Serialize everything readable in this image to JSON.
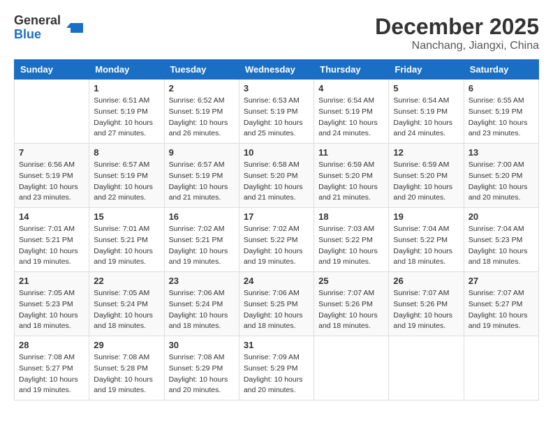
{
  "logo": {
    "general": "General",
    "blue": "Blue"
  },
  "title": "December 2025",
  "location": "Nanchang, Jiangxi, China",
  "headers": [
    "Sunday",
    "Monday",
    "Tuesday",
    "Wednesday",
    "Thursday",
    "Friday",
    "Saturday"
  ],
  "weeks": [
    [
      {
        "day": "",
        "sunrise": "",
        "sunset": "",
        "daylight": ""
      },
      {
        "day": "1",
        "sunrise": "Sunrise: 6:51 AM",
        "sunset": "Sunset: 5:19 PM",
        "daylight": "Daylight: 10 hours and 27 minutes."
      },
      {
        "day": "2",
        "sunrise": "Sunrise: 6:52 AM",
        "sunset": "Sunset: 5:19 PM",
        "daylight": "Daylight: 10 hours and 26 minutes."
      },
      {
        "day": "3",
        "sunrise": "Sunrise: 6:53 AM",
        "sunset": "Sunset: 5:19 PM",
        "daylight": "Daylight: 10 hours and 25 minutes."
      },
      {
        "day": "4",
        "sunrise": "Sunrise: 6:54 AM",
        "sunset": "Sunset: 5:19 PM",
        "daylight": "Daylight: 10 hours and 24 minutes."
      },
      {
        "day": "5",
        "sunrise": "Sunrise: 6:54 AM",
        "sunset": "Sunset: 5:19 PM",
        "daylight": "Daylight: 10 hours and 24 minutes."
      },
      {
        "day": "6",
        "sunrise": "Sunrise: 6:55 AM",
        "sunset": "Sunset: 5:19 PM",
        "daylight": "Daylight: 10 hours and 23 minutes."
      }
    ],
    [
      {
        "day": "7",
        "sunrise": "Sunrise: 6:56 AM",
        "sunset": "Sunset: 5:19 PM",
        "daylight": "Daylight: 10 hours and 23 minutes."
      },
      {
        "day": "8",
        "sunrise": "Sunrise: 6:57 AM",
        "sunset": "Sunset: 5:19 PM",
        "daylight": "Daylight: 10 hours and 22 minutes."
      },
      {
        "day": "9",
        "sunrise": "Sunrise: 6:57 AM",
        "sunset": "Sunset: 5:19 PM",
        "daylight": "Daylight: 10 hours and 21 minutes."
      },
      {
        "day": "10",
        "sunrise": "Sunrise: 6:58 AM",
        "sunset": "Sunset: 5:20 PM",
        "daylight": "Daylight: 10 hours and 21 minutes."
      },
      {
        "day": "11",
        "sunrise": "Sunrise: 6:59 AM",
        "sunset": "Sunset: 5:20 PM",
        "daylight": "Daylight: 10 hours and 21 minutes."
      },
      {
        "day": "12",
        "sunrise": "Sunrise: 6:59 AM",
        "sunset": "Sunset: 5:20 PM",
        "daylight": "Daylight: 10 hours and 20 minutes."
      },
      {
        "day": "13",
        "sunrise": "Sunrise: 7:00 AM",
        "sunset": "Sunset: 5:20 PM",
        "daylight": "Daylight: 10 hours and 20 minutes."
      }
    ],
    [
      {
        "day": "14",
        "sunrise": "Sunrise: 7:01 AM",
        "sunset": "Sunset: 5:21 PM",
        "daylight": "Daylight: 10 hours and 19 minutes."
      },
      {
        "day": "15",
        "sunrise": "Sunrise: 7:01 AM",
        "sunset": "Sunset: 5:21 PM",
        "daylight": "Daylight: 10 hours and 19 minutes."
      },
      {
        "day": "16",
        "sunrise": "Sunrise: 7:02 AM",
        "sunset": "Sunset: 5:21 PM",
        "daylight": "Daylight: 10 hours and 19 minutes."
      },
      {
        "day": "17",
        "sunrise": "Sunrise: 7:02 AM",
        "sunset": "Sunset: 5:22 PM",
        "daylight": "Daylight: 10 hours and 19 minutes."
      },
      {
        "day": "18",
        "sunrise": "Sunrise: 7:03 AM",
        "sunset": "Sunset: 5:22 PM",
        "daylight": "Daylight: 10 hours and 19 minutes."
      },
      {
        "day": "19",
        "sunrise": "Sunrise: 7:04 AM",
        "sunset": "Sunset: 5:22 PM",
        "daylight": "Daylight: 10 hours and 18 minutes."
      },
      {
        "day": "20",
        "sunrise": "Sunrise: 7:04 AM",
        "sunset": "Sunset: 5:23 PM",
        "daylight": "Daylight: 10 hours and 18 minutes."
      }
    ],
    [
      {
        "day": "21",
        "sunrise": "Sunrise: 7:05 AM",
        "sunset": "Sunset: 5:23 PM",
        "daylight": "Daylight: 10 hours and 18 minutes."
      },
      {
        "day": "22",
        "sunrise": "Sunrise: 7:05 AM",
        "sunset": "Sunset: 5:24 PM",
        "daylight": "Daylight: 10 hours and 18 minutes."
      },
      {
        "day": "23",
        "sunrise": "Sunrise: 7:06 AM",
        "sunset": "Sunset: 5:24 PM",
        "daylight": "Daylight: 10 hours and 18 minutes."
      },
      {
        "day": "24",
        "sunrise": "Sunrise: 7:06 AM",
        "sunset": "Sunset: 5:25 PM",
        "daylight": "Daylight: 10 hours and 18 minutes."
      },
      {
        "day": "25",
        "sunrise": "Sunrise: 7:07 AM",
        "sunset": "Sunset: 5:26 PM",
        "daylight": "Daylight: 10 hours and 18 minutes."
      },
      {
        "day": "26",
        "sunrise": "Sunrise: 7:07 AM",
        "sunset": "Sunset: 5:26 PM",
        "daylight": "Daylight: 10 hours and 19 minutes."
      },
      {
        "day": "27",
        "sunrise": "Sunrise: 7:07 AM",
        "sunset": "Sunset: 5:27 PM",
        "daylight": "Daylight: 10 hours and 19 minutes."
      }
    ],
    [
      {
        "day": "28",
        "sunrise": "Sunrise: 7:08 AM",
        "sunset": "Sunset: 5:27 PM",
        "daylight": "Daylight: 10 hours and 19 minutes."
      },
      {
        "day": "29",
        "sunrise": "Sunrise: 7:08 AM",
        "sunset": "Sunset: 5:28 PM",
        "daylight": "Daylight: 10 hours and 19 minutes."
      },
      {
        "day": "30",
        "sunrise": "Sunrise: 7:08 AM",
        "sunset": "Sunset: 5:29 PM",
        "daylight": "Daylight: 10 hours and 20 minutes."
      },
      {
        "day": "31",
        "sunrise": "Sunrise: 7:09 AM",
        "sunset": "Sunset: 5:29 PM",
        "daylight": "Daylight: 10 hours and 20 minutes."
      },
      {
        "day": "",
        "sunrise": "",
        "sunset": "",
        "daylight": ""
      },
      {
        "day": "",
        "sunrise": "",
        "sunset": "",
        "daylight": ""
      },
      {
        "day": "",
        "sunrise": "",
        "sunset": "",
        "daylight": ""
      }
    ]
  ]
}
